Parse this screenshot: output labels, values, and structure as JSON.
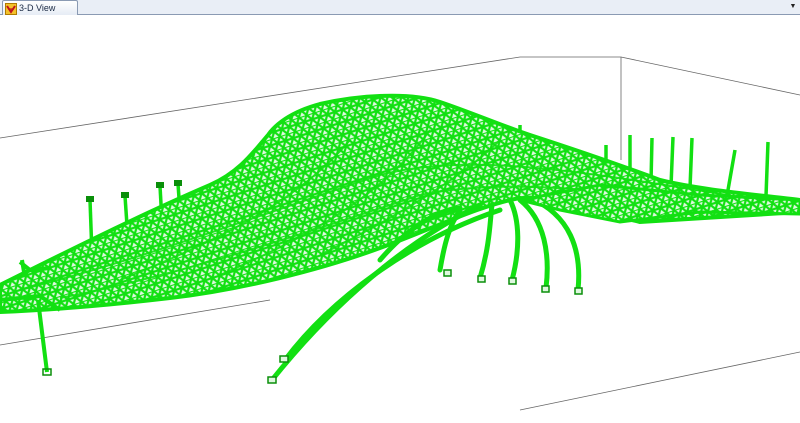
{
  "app": {
    "icon_name": "sap-logo-icon"
  },
  "tabs": [
    {
      "label": "3-D View",
      "active": true
    }
  ],
  "tab_menu": {
    "icon_name": "chevron-down-icon",
    "glyph": "▼"
  },
  "view": {
    "background": "#ffffff",
    "frame_color": "#666666",
    "structure_color": "#12e012",
    "structure_dark": "#0a8f0a"
  }
}
